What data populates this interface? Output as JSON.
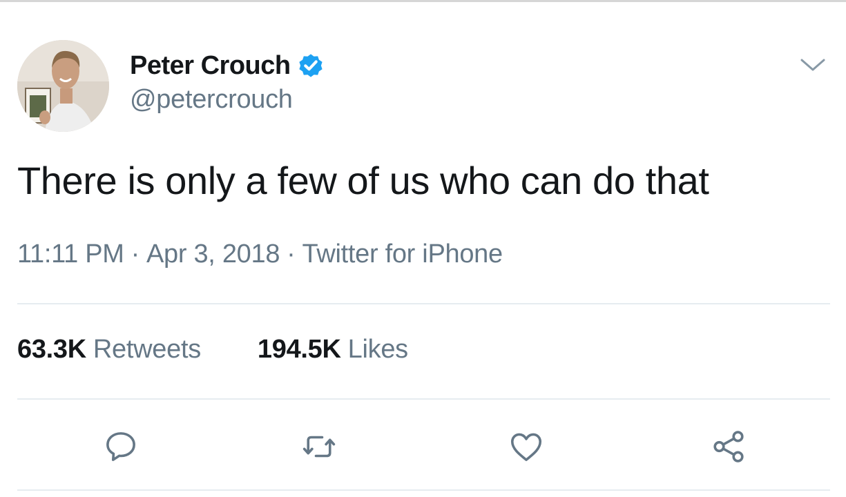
{
  "user": {
    "display_name": "Peter Crouch",
    "handle": "@petercrouch",
    "verified": true,
    "avatar_icon": "profile-photo"
  },
  "tweet": {
    "text": "There is only a few of us who can do that",
    "time": "11:11 PM",
    "separator": "·",
    "date": "Apr 3, 2018",
    "source": "Twitter for iPhone"
  },
  "stats": {
    "retweets_count": "63.3K",
    "retweets_label": "Retweets",
    "likes_count": "194.5K",
    "likes_label": "Likes"
  },
  "actions": [
    {
      "name": "reply",
      "icon": "speech-bubble-icon"
    },
    {
      "name": "retweet",
      "icon": "retweet-arrows-icon"
    },
    {
      "name": "like",
      "icon": "heart-icon"
    },
    {
      "name": "share",
      "icon": "share-nodes-icon"
    }
  ],
  "colors": {
    "primary_text": "#14171a",
    "secondary_text": "#657786",
    "verified_blue": "#1da1f2",
    "divider": "#e6ecf0"
  }
}
